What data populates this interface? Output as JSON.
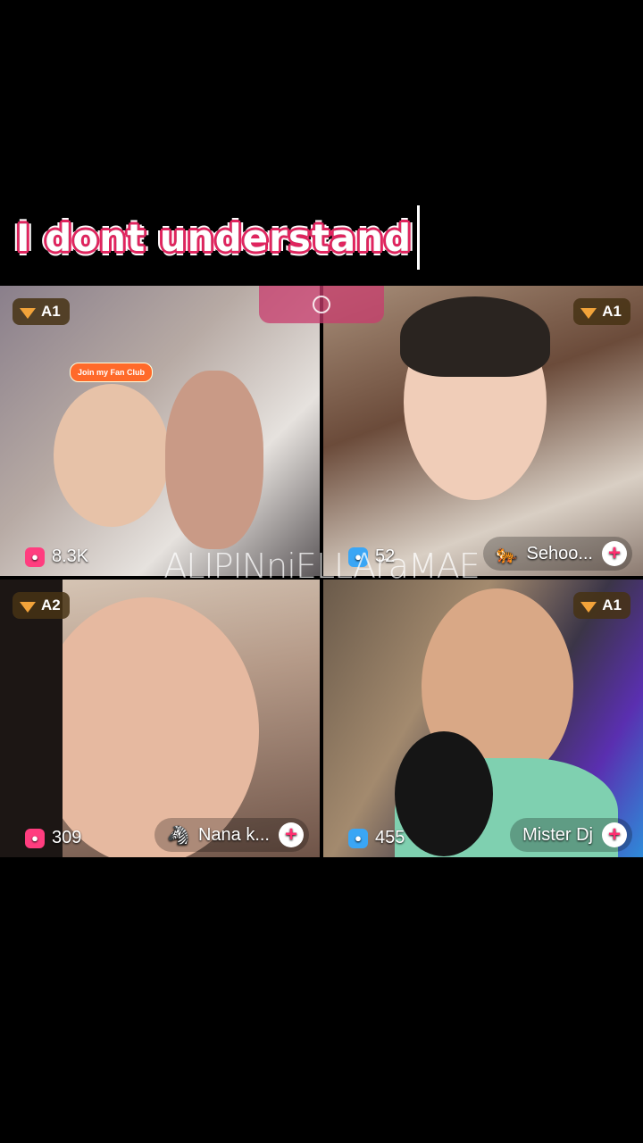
{
  "caption": "I dont understand",
  "watermark": "ALIPINniELLAraMAE",
  "tiles": [
    {
      "rank": "A1",
      "count": "8.3K",
      "name": "",
      "fanclub": "Join my Fan Club",
      "count_icon": "pink"
    },
    {
      "rank": "A1",
      "count": "52",
      "name": "Sehoo...",
      "name_icon": "🐅",
      "count_icon": "blue"
    },
    {
      "rank": "A2",
      "count": "309",
      "name": "Nana k...",
      "name_icon": "🦓",
      "count_icon": "pink"
    },
    {
      "rank": "A1",
      "count": "455",
      "name": "Mister Dj",
      "name_icon": "",
      "count_icon": "blue"
    }
  ],
  "colors": {
    "caption_outline": "#e0245e",
    "accent_pink": "#ff3d7f",
    "accent_blue": "#3aa6f5",
    "gem": "#f2a33a"
  }
}
